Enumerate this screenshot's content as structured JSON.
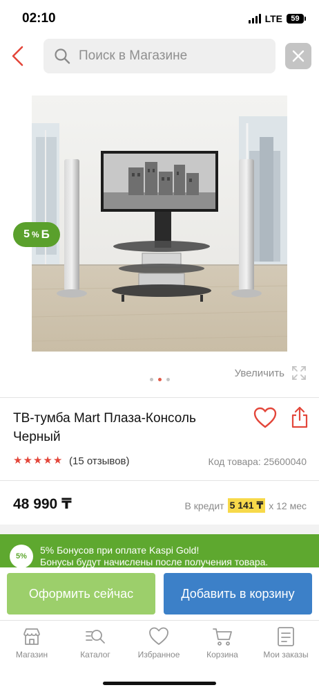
{
  "status_bar": {
    "time": "02:10",
    "network": "LTE",
    "battery": "59"
  },
  "search": {
    "placeholder": "Поиск в Магазине",
    "icons": {
      "back": "chevron-left-icon",
      "search": "search-icon",
      "clear": "close-icon"
    }
  },
  "product": {
    "bonus_badge": {
      "percent": "5",
      "percent_sign": "%",
      "currency": "Б"
    },
    "zoom_label": "Увеличить",
    "image_dots": {
      "count": 3,
      "active_index": 1
    },
    "title": "ТВ-тумба Mart Плаза-Консоль Черный",
    "rating": {
      "stars": 5,
      "reviews_label": "(15 отзывов)"
    },
    "sku_label": "Код товара: 25600040",
    "price": "48 990 ₸",
    "credit": {
      "prefix": "В кредит",
      "amount": "5 141 ₸",
      "suffix": "х 12 мес"
    }
  },
  "bonus_banner": {
    "badge": "5%",
    "line1": "5% Бонусов при оплате Kaspi Gold!",
    "line2": "Бонусы будут начислены после получения товара."
  },
  "actions": {
    "checkout_now": "Оформить сейчас",
    "add_to_cart": "Добавить в корзину"
  },
  "tabbar": {
    "items": [
      {
        "label": "Магазин",
        "icon": "shop-icon"
      },
      {
        "label": "Каталог",
        "icon": "catalog-search-icon"
      },
      {
        "label": "Избранное",
        "icon": "heart-icon"
      },
      {
        "label": "Корзина",
        "icon": "cart-icon"
      },
      {
        "label": "Мои заказы",
        "icon": "orders-icon"
      }
    ]
  },
  "colors": {
    "accent_red": "#e3463a",
    "kaspi_green": "#5ea82f",
    "button_green": "#9ccf6b",
    "button_blue": "#3c80c8",
    "credit_highlight": "#f7d94a"
  }
}
